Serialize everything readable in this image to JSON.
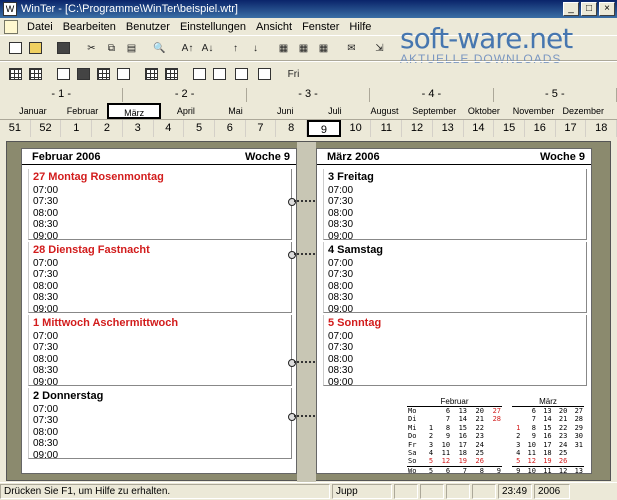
{
  "window": {
    "title": "WinTer - [C:\\Programme\\WinTer\\beispiel.wtr]",
    "buttons": [
      "_",
      "□",
      "×"
    ]
  },
  "menu": [
    "Datei",
    "Bearbeiten",
    "Benutzer",
    "Einstellungen",
    "Ansicht",
    "Fenster",
    "Hilfe"
  ],
  "watermark": {
    "brand": "soft-ware.net",
    "tagline": "AKTUELLE DOWNLOADS"
  },
  "toolbar1": [
    {
      "icon": "new-document-icon",
      "glyph": ""
    },
    {
      "icon": "open-folder-icon",
      "glyph": ""
    },
    {
      "icon": "print-icon",
      "glyph": ""
    },
    {
      "icon": "cut-icon",
      "glyph": "✂"
    },
    {
      "icon": "copy-icon",
      "glyph": "⧉"
    },
    {
      "icon": "paste-icon",
      "glyph": "▤"
    },
    {
      "icon": "find-icon",
      "glyph": "🔍"
    },
    {
      "icon": "sort-ascending-icon",
      "glyph": "A↑"
    },
    {
      "icon": "sort-descending-icon",
      "glyph": "A↓"
    },
    {
      "icon": "move-up-icon",
      "glyph": "↑"
    },
    {
      "icon": "move-down-icon",
      "glyph": "↓"
    },
    {
      "icon": "calendar-icon",
      "glyph": "▦"
    },
    {
      "icon": "calendar-week-icon",
      "glyph": "▦"
    },
    {
      "icon": "calendar-month-icon",
      "glyph": "▦"
    },
    {
      "icon": "mail-icon",
      "glyph": "✉"
    },
    {
      "icon": "export-icon",
      "glyph": "⇲"
    },
    {
      "icon": "tools-icon",
      "glyph": ""
    },
    {
      "icon": "help-pointer-icon",
      "glyph": "?"
    }
  ],
  "toolbar2": [
    {
      "icon": "list-view-icon"
    },
    {
      "icon": "grid-view-icon"
    },
    {
      "icon": "day-view-icon"
    },
    {
      "icon": "week-view-icon"
    },
    {
      "icon": "month-view-icon"
    },
    {
      "icon": "column-view-icon"
    },
    {
      "icon": "table-view-icon"
    },
    {
      "icon": "calendar-grid-icon"
    },
    {
      "icon": "toggle-view-icon"
    },
    {
      "icon": "dual-view-icon"
    },
    {
      "icon": "all-view-icon"
    },
    {
      "icon": "hm-view-icon"
    },
    {
      "icon": "fri-view-icon",
      "glyph": "Fri"
    }
  ],
  "bimonth_labels": [
    "- 1 -",
    "- 2 -",
    "- 3 -",
    "- 4 -",
    "- 5 -"
  ],
  "months": [
    "Januar",
    "Februar",
    "März",
    "April",
    "Mai",
    "Juni",
    "Juli",
    "August",
    "September",
    "Oktober",
    "November",
    "Dezember"
  ],
  "selected_month": "März",
  "weeks": [
    "51",
    "52",
    "1",
    "2",
    "3",
    "4",
    "5",
    "6",
    "7",
    "8",
    "9",
    "10",
    "11",
    "12",
    "13",
    "14",
    "15",
    "16",
    "17",
    "18"
  ],
  "selected_week": "9",
  "times": [
    "07:00",
    "07:30",
    "08:00",
    "08:30",
    "09:00"
  ],
  "left_page": {
    "month": "Februar 2006",
    "week": "Woche 9",
    "days": [
      {
        "label": "27 Montag Rosenmontag",
        "red": true
      },
      {
        "label": "28 Dienstag Fastnacht",
        "red": true
      },
      {
        "label": "1 Mittwoch Aschermittwoch",
        "red": true
      },
      {
        "label": "2 Donnerstag",
        "red": false
      }
    ]
  },
  "right_page": {
    "month": "März 2006",
    "week": "Woche 9",
    "days": [
      {
        "label": "3 Freitag",
        "red": false
      },
      {
        "label": "4 Samstag",
        "red": false
      },
      {
        "label": "5 Sonntag",
        "red": true
      }
    ]
  },
  "mini_calendars": [
    {
      "title": "Februar",
      "rows": [
        {
          "day": "Mo",
          "nums": [
            "",
            "6",
            "13",
            "20",
            "27"
          ],
          "red": [
            false,
            false,
            false,
            false,
            true
          ]
        },
        {
          "day": "Di",
          "nums": [
            "",
            "7",
            "14",
            "21",
            "28"
          ],
          "red": [
            false,
            false,
            false,
            false,
            true
          ]
        },
        {
          "day": "Mi",
          "nums": [
            "1",
            "8",
            "15",
            "22",
            ""
          ],
          "red": [
            false,
            false,
            false,
            false,
            false
          ]
        },
        {
          "day": "Do",
          "nums": [
            "2",
            "9",
            "16",
            "23",
            ""
          ],
          "red": [
            false,
            false,
            false,
            false,
            false
          ]
        },
        {
          "day": "Fr",
          "nums": [
            "3",
            "10",
            "17",
            "24",
            ""
          ],
          "red": [
            false,
            false,
            false,
            false,
            false
          ]
        },
        {
          "day": "Sa",
          "nums": [
            "4",
            "11",
            "18",
            "25",
            ""
          ],
          "red": [
            false,
            false,
            false,
            false,
            false
          ]
        },
        {
          "day": "So",
          "nums": [
            "5",
            "12",
            "19",
            "26",
            ""
          ],
          "red": [
            true,
            true,
            true,
            true,
            false
          ]
        },
        {
          "day": "Wo",
          "nums": [
            "5",
            "6",
            "7",
            "8",
            "9"
          ],
          "red": [
            false,
            false,
            false,
            false,
            false
          ]
        }
      ]
    },
    {
      "title": "März",
      "rows": [
        {
          "day": "",
          "nums": [
            "",
            "6",
            "13",
            "20",
            "27"
          ],
          "red": [
            false,
            false,
            false,
            false,
            false
          ]
        },
        {
          "day": "",
          "nums": [
            "",
            "7",
            "14",
            "21",
            "28"
          ],
          "red": [
            false,
            false,
            false,
            false,
            false
          ]
        },
        {
          "day": "",
          "nums": [
            "1",
            "8",
            "15",
            "22",
            "29"
          ],
          "red": [
            true,
            false,
            false,
            false,
            false
          ]
        },
        {
          "day": "",
          "nums": [
            "2",
            "9",
            "16",
            "23",
            "30"
          ],
          "red": [
            false,
            false,
            false,
            false,
            false
          ]
        },
        {
          "day": "",
          "nums": [
            "3",
            "10",
            "17",
            "24",
            "31"
          ],
          "red": [
            false,
            false,
            false,
            false,
            false
          ]
        },
        {
          "day": "",
          "nums": [
            "4",
            "11",
            "18",
            "25",
            ""
          ],
          "red": [
            false,
            false,
            false,
            false,
            false
          ]
        },
        {
          "day": "",
          "nums": [
            "5",
            "12",
            "19",
            "26",
            ""
          ],
          "red": [
            true,
            true,
            true,
            true,
            false
          ]
        },
        {
          "day": "",
          "nums": [
            "9",
            "10",
            "11",
            "12",
            "13"
          ],
          "red": [
            false,
            false,
            false,
            false,
            false
          ]
        }
      ]
    }
  ],
  "status": {
    "message": "Drücken Sie F1, um Hilfe zu erhalten.",
    "user": "Jupp",
    "time": "23:49",
    "year": "2006"
  },
  "colors": {
    "holiday_red": "#d21c1c",
    "planner_bg": "#8b8a6e",
    "title_bar": "#0a246a"
  }
}
